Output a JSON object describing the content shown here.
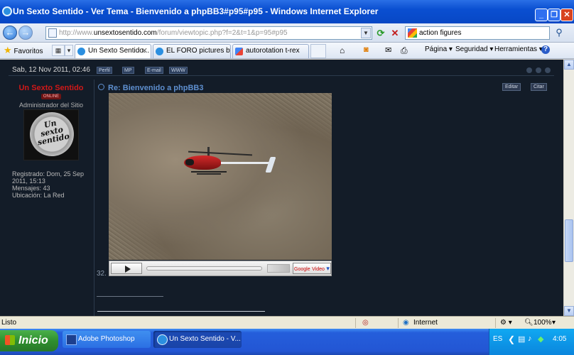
{
  "window": {
    "title": "Un Sexto Sentido - Ver Tema - Bienvenido a phpBB3#p95#p95 - Windows Internet Explorer",
    "minimize": "_",
    "maximize": "❐",
    "close": "✕"
  },
  "address": {
    "prefix": "http://www.",
    "domain": "unsextosentido.com",
    "path": "/forum/viewtopic.php?f=2&t=1&p=95#p95"
  },
  "search": {
    "value": "action figures"
  },
  "toolbar": {
    "favorites": "Favoritos",
    "tabs": [
      {
        "label": "Un Sexto Sentido...",
        "active": true
      },
      {
        "label": "EL FORO pictures by ...",
        "active": false
      },
      {
        "label": "autorotation t-rex",
        "active": false
      }
    ],
    "pagina": "Página ▾",
    "seguridad": "Seguridad ▾",
    "herramientas": "Herramientas ▾",
    "help": "?"
  },
  "post": {
    "date": "Sab, 12 Nov 2011, 02:46",
    "buttons": {
      "perfil": "Perfil",
      "mp": "MP",
      "email": "E-mail",
      "www": "WWW"
    },
    "author": {
      "name": "Un Sexto Sentido",
      "status": "ONLINE",
      "role": "Administrador del Sitio",
      "avatar_text": "Un sexto sentido",
      "registered": "Registrado: Dom, 25 Sep 2011, 15:13",
      "messages": "Mensajes: 43",
      "location": "Ubicación: La Red"
    },
    "subject": "Re: Bienvenido a phpBB3",
    "edit": "Editar",
    "quote": "Citar",
    "video_brand": "Google",
    "video_brand_sub": "Video",
    "trail": "32."
  },
  "statusbar": {
    "text": "Listo",
    "zone": "Internet",
    "zoom": "100%"
  },
  "taskbar": {
    "start": "Inicio",
    "items": [
      {
        "label": "Adobe Photoshop"
      },
      {
        "label": "Un Sexto Sentido - V..."
      }
    ],
    "lang": "ES",
    "time": "4:05"
  }
}
